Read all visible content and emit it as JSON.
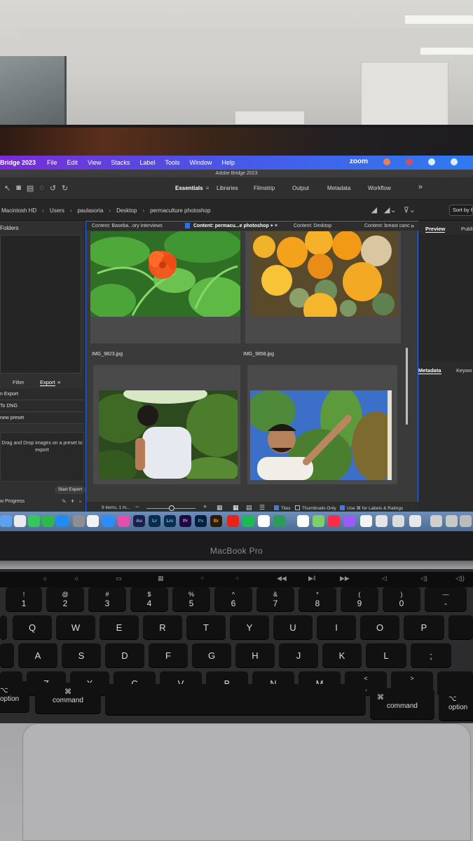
{
  "menubar": {
    "app_name": "Bridge 2023",
    "items": [
      "File",
      "Edit",
      "View",
      "Stacks",
      "Label",
      "Tools",
      "Window",
      "Help"
    ],
    "zoom_label": "zoom"
  },
  "window_title": "Adobe Bridge 2023",
  "workspaces": [
    "Essentials",
    "Libraries",
    "Filmstrip",
    "Output",
    "Metadata",
    "Workflow"
  ],
  "path": {
    "crumbs": [
      "Macintosh HD",
      "Users",
      "paulasoria",
      "Desktop",
      "permaculture photoshop"
    ],
    "sort_label": "Sort by Fi"
  },
  "left_panel": {
    "folders_label": "Folders",
    "tabs": [
      "Filter",
      "Export"
    ],
    "export_rows": [
      "n Export",
      "To DNG",
      "new preset"
    ],
    "drop_text": "Drag and Drop images on a preset to export",
    "start_export": "Start Export",
    "progress_label": "w Progress"
  },
  "content": {
    "tabs": [
      "Content: Baseba...ory interviews",
      "Content: permacu...e photoshop",
      "Content: Desktop",
      "Content: breast canc"
    ],
    "thumbnails": [
      {
        "name": "IMG_9823.jpg",
        "subject": "orange nasturtium flower"
      },
      {
        "name": "IMG_9858.jpg",
        "subject": "pile of citrus fruit"
      },
      {
        "name": "",
        "subject": "man in white t-shirt in garden"
      },
      {
        "name": "",
        "subject": "smiling man reaching to plants"
      }
    ],
    "status": {
      "count": "9 items, 1 hi...",
      "tiles": "Tiles",
      "thumbnails_only": "Thumbnails Only",
      "labels": "Use ⌘ for Labels & Ratings"
    }
  },
  "right_panel": {
    "tabs_top": [
      "Preview",
      "Publi"
    ],
    "tabs_bottom": [
      "Metadata",
      "Keywo"
    ]
  },
  "dock": {
    "apps": [
      "Finder",
      "Launchpad",
      "Messages",
      "FaceTime",
      "App Store",
      "Settings",
      "Chrome",
      "Zoom",
      "Photos",
      "Au",
      "Lr",
      "Lrc",
      "Pr",
      "Ps",
      "Br",
      "Acrobat",
      "Spotify",
      "Slack",
      "Books",
      "Calendar",
      "Maps",
      "Music",
      "Podcasts",
      "Notes",
      "Preview",
      "Files"
    ]
  },
  "laptop": {
    "brand": "MacBook Pro"
  },
  "keyboard": {
    "number_row": [
      [
        "!",
        "1"
      ],
      [
        "@",
        "2"
      ],
      [
        "#",
        "3"
      ],
      [
        "$",
        "4"
      ],
      [
        "%",
        "5"
      ],
      [
        "^",
        "6"
      ],
      [
        "&",
        "7"
      ],
      [
        "*",
        "8"
      ],
      [
        "(",
        "9"
      ],
      [
        ")",
        "0"
      ],
      [
        "—",
        "-"
      ]
    ],
    "row_q": [
      "Q",
      "W",
      "E",
      "R",
      "T",
      "Y",
      "U",
      "I",
      "O",
      "P"
    ],
    "row_a": [
      "A",
      "S",
      "D",
      "F",
      "G",
      "H",
      "J",
      "K",
      "L"
    ],
    "row_z": [
      "Z",
      "X",
      "C",
      "V",
      "B",
      "N",
      "M"
    ],
    "punct": [
      [
        "<",
        ","
      ],
      [
        ">",
        "."
      ]
    ],
    "option_label": "option",
    "command_label": "command",
    "command_symbol": "⌘",
    "option_symbol": "⌥"
  },
  "colors": {
    "menubar_start": "#7a2ad6",
    "menubar_end": "#2f7bf0",
    "selection_blue": "#2f6fe8",
    "panel_dark": "#2b2b2b"
  }
}
